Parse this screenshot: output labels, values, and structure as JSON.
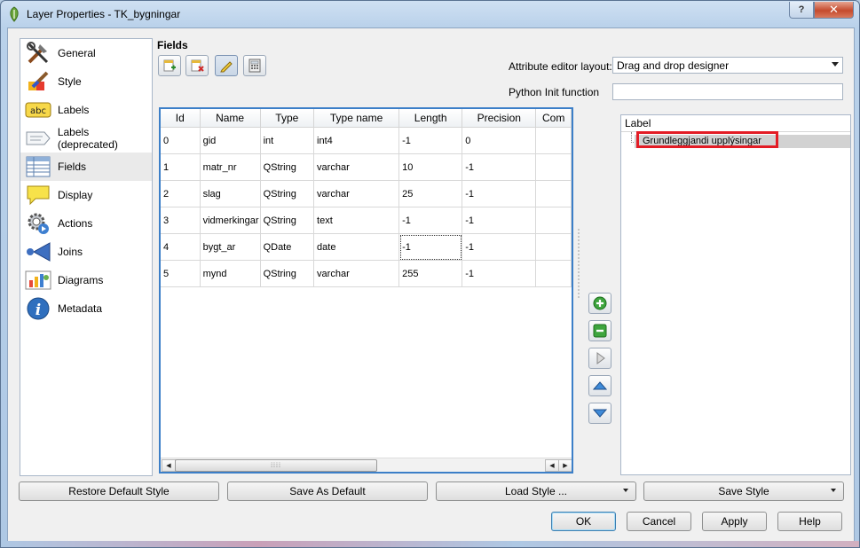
{
  "window": {
    "title": "Layer Properties - TK_bygningar",
    "help_glyph": "?",
    "close_glyph": "✕"
  },
  "sidebar": {
    "items": [
      {
        "label": "General",
        "icon": "tools-icon"
      },
      {
        "label": "Style",
        "icon": "paintbrush-icon"
      },
      {
        "label": "Labels",
        "icon": "abc-icon"
      },
      {
        "label": "Labels (deprecated)",
        "icon": "label-tag-icon"
      },
      {
        "label": "Fields",
        "icon": "table-icon",
        "selected": true
      },
      {
        "label": "Display",
        "icon": "speech-bubble-icon"
      },
      {
        "label": "Actions",
        "icon": "gear-icon"
      },
      {
        "label": "Joins",
        "icon": "join-arrow-icon"
      },
      {
        "label": "Diagrams",
        "icon": "diagram-icon"
      },
      {
        "label": "Metadata",
        "icon": "info-icon"
      }
    ]
  },
  "fields_panel": {
    "title": "Fields",
    "attribute_editor_layout_label": "Attribute editor layout:",
    "attribute_editor_layout_value": "Drag and drop designer",
    "python_init_label": "Python Init function",
    "python_init_value": ""
  },
  "table": {
    "columns": [
      "Id",
      "Name",
      "Type",
      "Type name",
      "Length",
      "Precision",
      "Com"
    ],
    "rows": [
      [
        "0",
        "gid",
        "int",
        "int4",
        "-1",
        "0",
        ""
      ],
      [
        "1",
        "matr_nr",
        "QString",
        "varchar",
        "10",
        "-1",
        ""
      ],
      [
        "2",
        "slag",
        "QString",
        "varchar",
        "25",
        "-1",
        ""
      ],
      [
        "3",
        "vidmerkingar",
        "QString",
        "text",
        "-1",
        "-1",
        ""
      ],
      [
        "4",
        "bygt_ar",
        "QDate",
        "date",
        "-1",
        "-1",
        ""
      ],
      [
        "5",
        "mynd",
        "QString",
        "varchar",
        "255",
        "-1",
        ""
      ]
    ]
  },
  "tree": {
    "header": "Label",
    "items": [
      "Grundleggjandi upplýsingar"
    ]
  },
  "buttons": {
    "restore_default_style": "Restore Default Style",
    "save_as_default": "Save As Default",
    "load_style": "Load Style ...",
    "save_style": "Save Style",
    "ok": "OK",
    "cancel": "Cancel",
    "apply": "Apply",
    "help": "Help"
  },
  "colors": {
    "accent_border": "#3c7fc8",
    "highlight_box": "#e31c25"
  }
}
